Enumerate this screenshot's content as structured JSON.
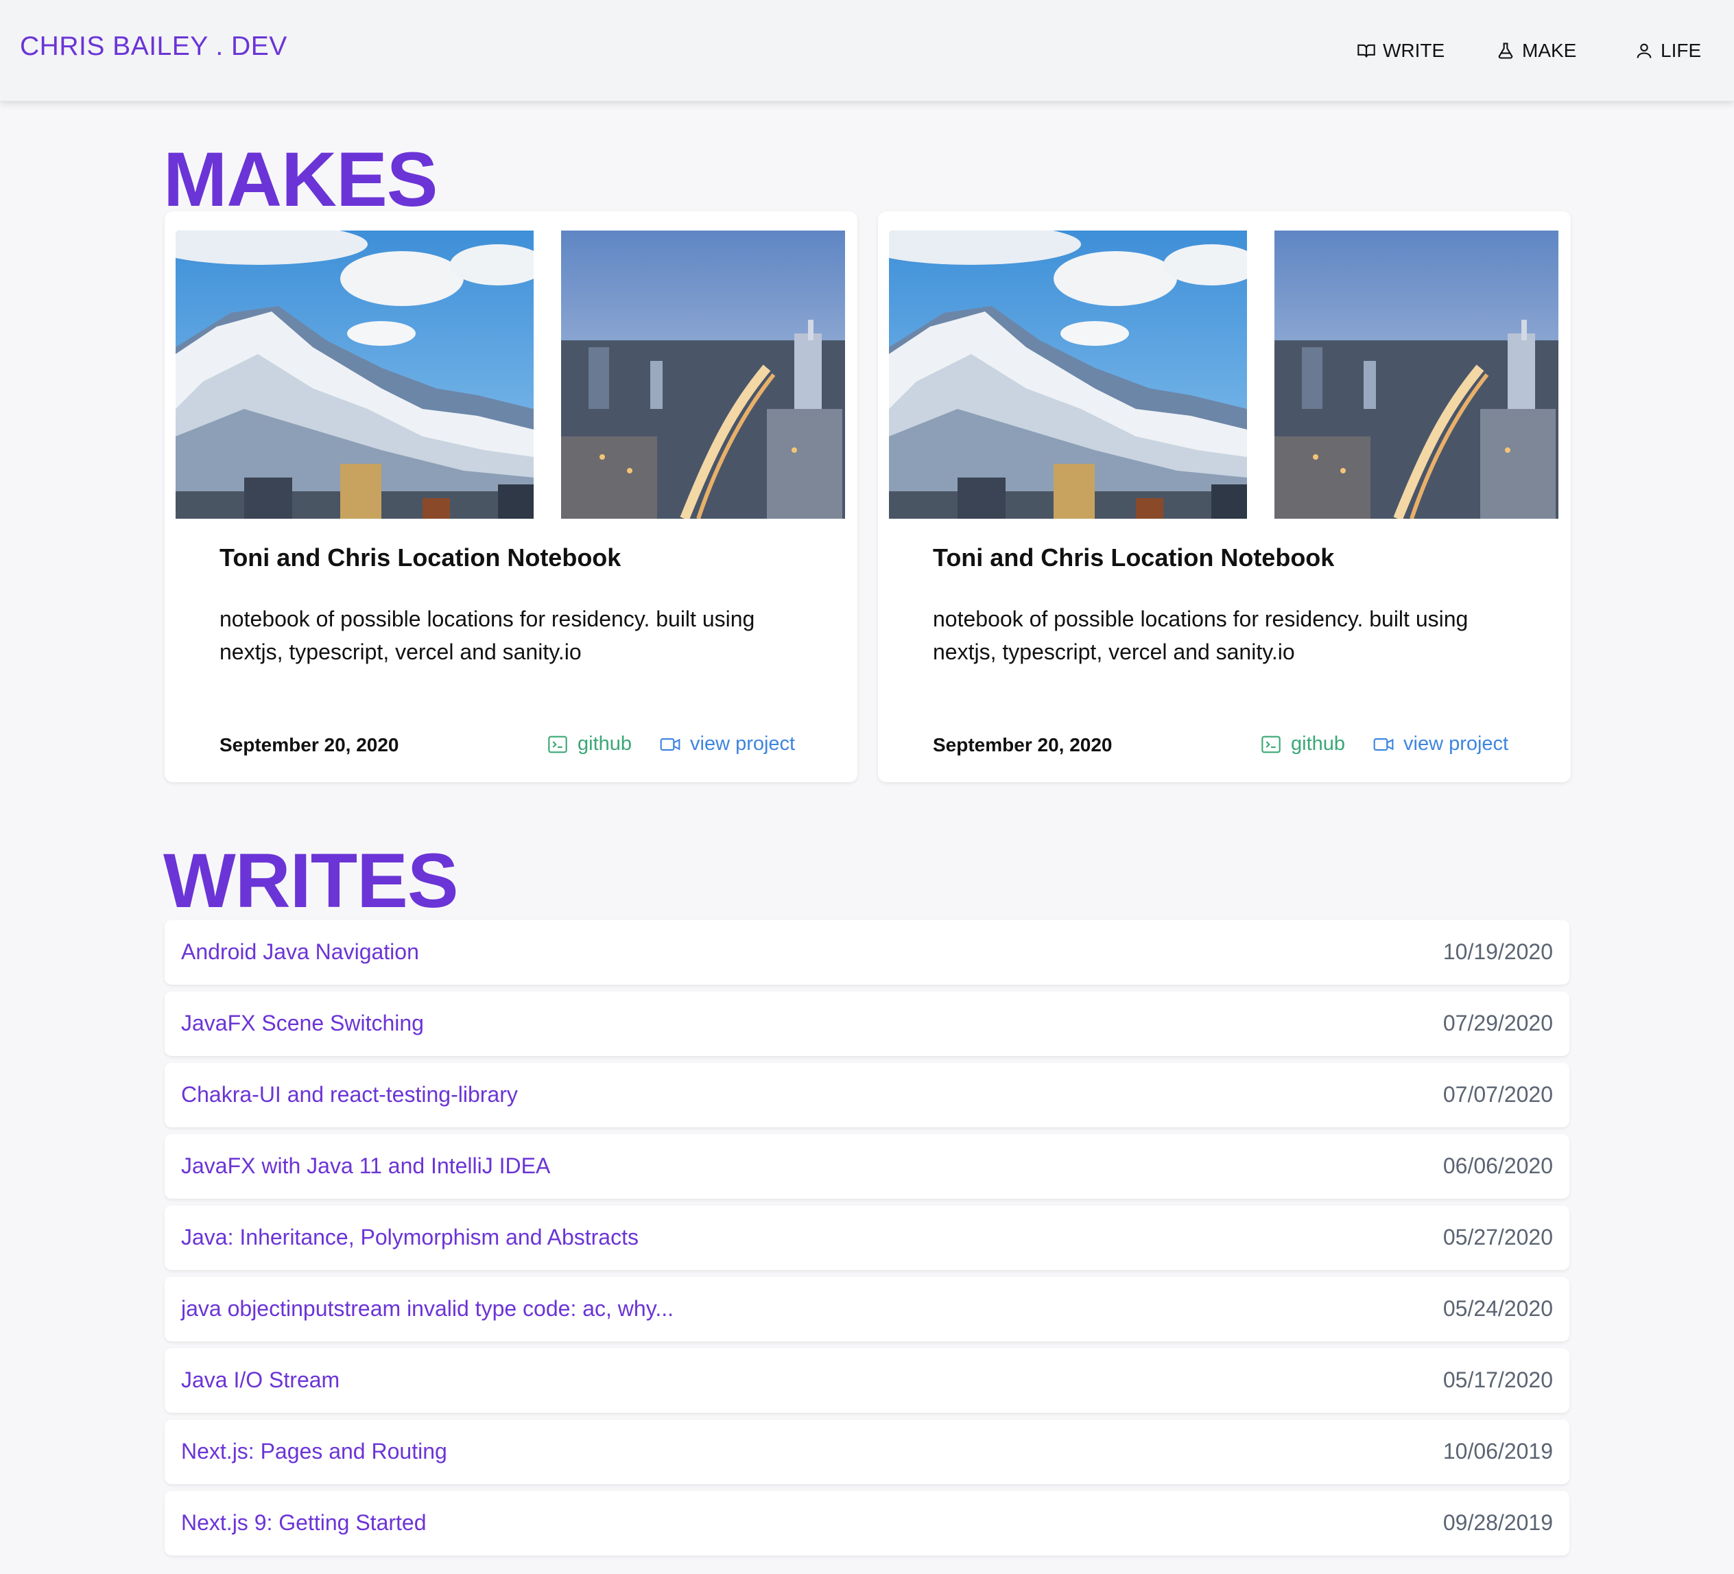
{
  "header": {
    "logo": "CHRIS BAILEY . DEV",
    "nav": [
      {
        "label": "WRITE",
        "icon": "book-icon"
      },
      {
        "label": "MAKE",
        "icon": "flask-icon"
      },
      {
        "label": "LIFE",
        "icon": "user-icon"
      }
    ]
  },
  "makes": {
    "title": "MAKES",
    "cards": [
      {
        "title": "Toni and Chris Location Notebook",
        "description": "notebook of possible locations for residency. built using nextjs, typescript, vercel and sanity.io",
        "date": "September 20, 2020",
        "github_label": "github",
        "view_label": "view project"
      },
      {
        "title": "Toni and Chris Location Notebook",
        "description": "notebook of possible locations for residency. built using nextjs, typescript, vercel and sanity.io",
        "date": "September 20, 2020",
        "github_label": "github",
        "view_label": "view project"
      }
    ]
  },
  "writes": {
    "title": "WRITES",
    "items": [
      {
        "title": "Android Java Navigation",
        "date": "10/19/2020"
      },
      {
        "title": "JavaFX Scene Switching",
        "date": "07/29/2020"
      },
      {
        "title": "Chakra-UI and react-testing-library",
        "date": "07/07/2020"
      },
      {
        "title": "JavaFX with Java 11 and IntelliJ IDEA",
        "date": "06/06/2020"
      },
      {
        "title": "Java: Inheritance, Polymorphism and Abstracts",
        "date": "05/27/2020"
      },
      {
        "title": "java objectinputstream invalid type code: ac, why...",
        "date": "05/24/2020"
      },
      {
        "title": "Java I/O Stream",
        "date": "05/17/2020"
      },
      {
        "title": "Next.js: Pages and Routing",
        "date": "10/06/2019"
      },
      {
        "title": "Next.js 9: Getting Started",
        "date": "09/28/2019"
      }
    ]
  },
  "colors": {
    "accent": "#6b34d6",
    "github": "#3aa776",
    "link": "#3e85de",
    "date_gray": "#5b6472"
  }
}
